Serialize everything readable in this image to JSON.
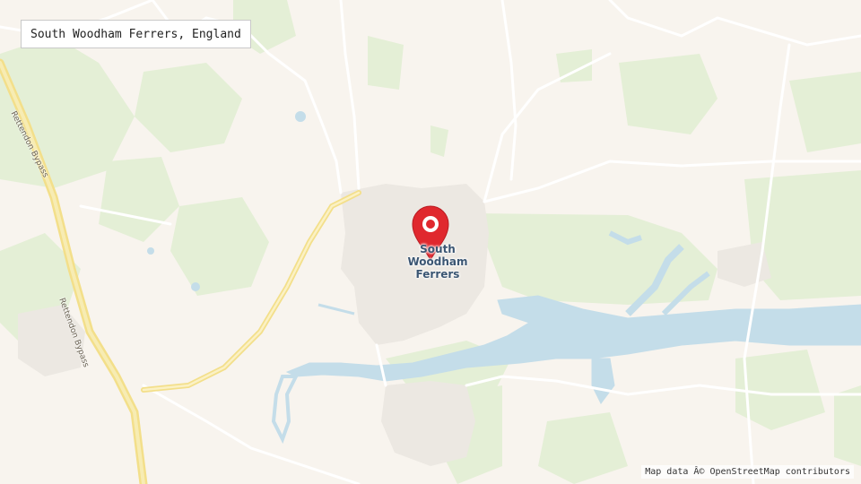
{
  "search": {
    "place_name": "South Woodham Ferrers, England"
  },
  "map": {
    "town_label": "South Woodham Ferrers",
    "roads": [
      "Rettendon Bypass",
      "Rettendon Bypass"
    ],
    "attribution": "Map data Â© OpenStreetMap contributors",
    "colors": {
      "land": "#f8f4ee",
      "green": "#e4efd6",
      "water": "#c4dde9",
      "road_major": "#f3df8a",
      "road_minor": "#ffffff",
      "built_up": "#ece8e2",
      "marker": "#e0282e"
    },
    "marker_icon": "map-pin-icon"
  }
}
